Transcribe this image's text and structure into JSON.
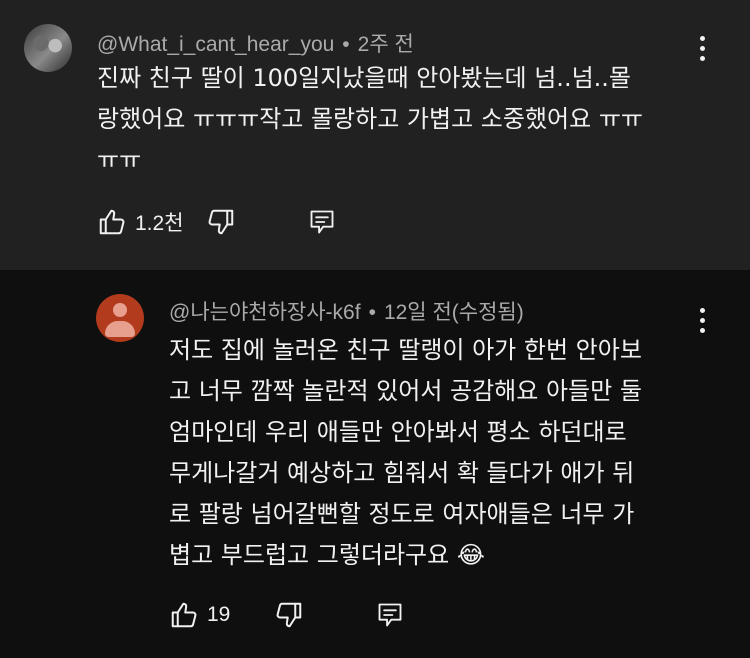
{
  "comments": [
    {
      "author": "@What_i_cant_hear_you",
      "separator": "•",
      "time": "2주 전",
      "text_lines": [
        "진짜 친구 딸이 100일지났을때 안아봤는데 넘..넘..몰",
        "랑했어요 ㅠㅠㅠ작고 몰랑하고 가볍고 소중했어요 ㅠㅠ",
        "ㅠㅠ"
      ],
      "like_count": "1.2천"
    },
    {
      "author": "@나는야천하장사-k6f",
      "separator": "•",
      "time": "12일 전(수정됨)",
      "text_lines": [
        "저도 집에 놀러온 친구 딸랭이 아가 한번 안아보",
        "고 너무 깜짝 놀란적 있어서 공감해요 아들만 둘",
        "엄마인데 우리 애들만 안아봐서 평소 하던대로",
        "무게나갈거 예상하고 힘줘서 확 들다가 애가 뒤",
        "로 팔랑 넘어갈뻔할 정도로 여자애들은 너무 가",
        "볍고 부드럽고 그렇더라구요 😂"
      ],
      "like_count": "19"
    }
  ],
  "icons": {
    "like": "thumbs-up-icon",
    "dislike": "thumbs-down-icon",
    "reply": "reply-comment-icon",
    "more": "more-vertical-icon"
  },
  "colors": {
    "top_background": "#212121",
    "reply_background": "#0f0f0f",
    "meta_text": "#aaaaaa",
    "body_text": "#f1f1f1",
    "default_avatar": "#b23b1e"
  }
}
